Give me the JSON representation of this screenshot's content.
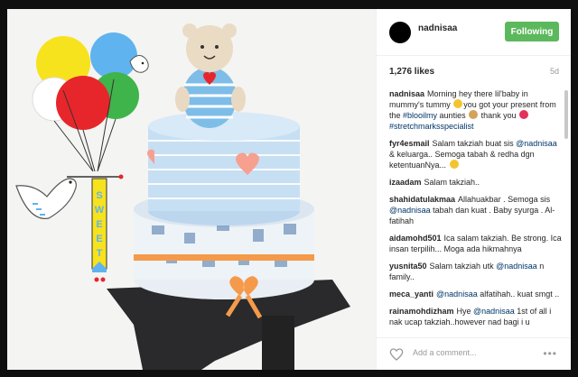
{
  "post": {
    "username": "nadnisaa",
    "follow_label": "Following",
    "likes": "1,276 likes",
    "age": "5d",
    "add_comment_placeholder": "Add a comment...",
    "more_label": "•••"
  },
  "photo": {
    "banner_letters": [
      "S",
      "W",
      "E",
      "E",
      "T"
    ],
    "colors": {
      "balloon_yellow": "#f7e21e",
      "balloon_blue": "#5fb3ef",
      "balloon_red": "#e7262b",
      "balloon_green": "#3fb44a",
      "cake_blue": "#cfe6f7",
      "ribbon_orange": "#f59a4a",
      "heart_pink": "#f7a08f"
    }
  },
  "comments": [
    {
      "user": "nadnisaa",
      "segments": [
        {
          "text": "Morning hey there lil'baby in mummy's tummy ",
          "type": "text"
        },
        {
          "text": "",
          "type": "emoji",
          "color": "#f4c430"
        },
        {
          "text": "you got your present from the ",
          "type": "text"
        },
        {
          "text": "#blooilmy",
          "type": "mention"
        },
        {
          "text": " aunties ",
          "type": "text"
        },
        {
          "text": "",
          "type": "emoji",
          "color": "#d4a25a"
        },
        {
          "text": " thank you ",
          "type": "text"
        },
        {
          "text": "",
          "type": "emoji",
          "color": "#e3335a"
        },
        {
          "text": " ",
          "type": "text"
        },
        {
          "text": "#stretchmarksspecialist",
          "type": "mention"
        }
      ]
    },
    {
      "user": "fyr4esmail",
      "segments": [
        {
          "text": "Salam takziah buat sis ",
          "type": "text"
        },
        {
          "text": "@nadnisaa",
          "type": "mention"
        },
        {
          "text": " & keluarga.. Semoga tabah & redha dgn ketentuanNya... ",
          "type": "text"
        },
        {
          "text": "",
          "type": "emoji",
          "color": "#f4c430"
        }
      ]
    },
    {
      "user": "izaadam",
      "segments": [
        {
          "text": "Salam takziah..",
          "type": "text"
        }
      ]
    },
    {
      "user": "shahidatulakmaa",
      "segments": [
        {
          "text": "Allahuakbar . Semoga sis ",
          "type": "text"
        },
        {
          "text": "@nadnisaa",
          "type": "mention"
        },
        {
          "text": " tabah dan kuat . Baby syurga . Al-fatihah",
          "type": "text"
        }
      ]
    },
    {
      "user": "aidamohd501",
      "segments": [
        {
          "text": "Ica salam takziah. Be strong. Ica insan terpilih... Moga ada hikmahnya",
          "type": "text"
        }
      ]
    },
    {
      "user": "yusnita50",
      "segments": [
        {
          "text": "Salam takziah utk ",
          "type": "text"
        },
        {
          "text": "@nadnisaa",
          "type": "mention"
        },
        {
          "text": " n family..",
          "type": "text"
        }
      ]
    },
    {
      "user": "meca_yanti",
      "segments": [
        {
          "text": "@nadnisaa",
          "type": "mention"
        },
        {
          "text": " alfatihah.. kuat smgt ..",
          "type": "text"
        }
      ]
    },
    {
      "user": "rainamohdizham",
      "segments": [
        {
          "text": "Hye ",
          "type": "text"
        },
        {
          "text": "@nadnisaa",
          "type": "mention"
        },
        {
          "text": " 1st of all i nak ucap takziah..however nad bagi i u",
          "type": "text"
        }
      ]
    }
  ]
}
